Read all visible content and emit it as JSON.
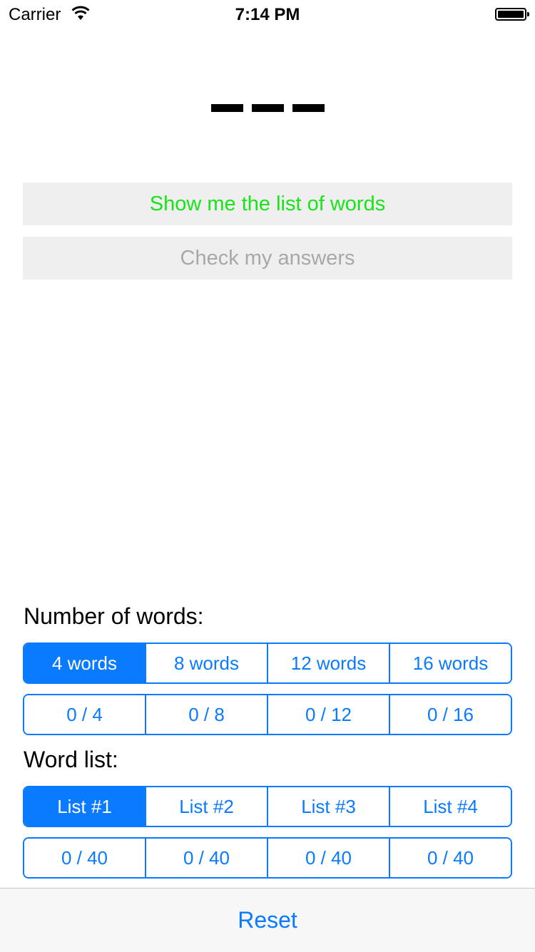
{
  "status_bar": {
    "carrier": "Carrier",
    "time": "7:14 PM",
    "wifi_icon": "wifi-icon",
    "battery_icon": "battery-icon",
    "battery_level": 1.0
  },
  "word_blanks": {
    "count": 3
  },
  "actions": {
    "show_list_label": "Show me the list of words",
    "check_answers_label": "Check my answers",
    "show_list_color": "#19e319",
    "check_answers_color": "#a8a8a8"
  },
  "number_of_words": {
    "label": "Number of words:",
    "options": [
      "4 words",
      "8 words",
      "12 words",
      "16 words"
    ],
    "selected_index": 0,
    "progress": [
      "0 / 4",
      "0 / 8",
      "0 / 12",
      "0 / 16"
    ]
  },
  "word_list": {
    "label": "Word list:",
    "options": [
      "List #1",
      "List #2",
      "List #3",
      "List #4"
    ],
    "selected_index": 0,
    "progress": [
      "0 / 40",
      "0 / 40",
      "0 / 40",
      "0 / 40"
    ]
  },
  "toolbar": {
    "reset_label": "Reset"
  },
  "colors": {
    "accent": "#0a7aff"
  }
}
